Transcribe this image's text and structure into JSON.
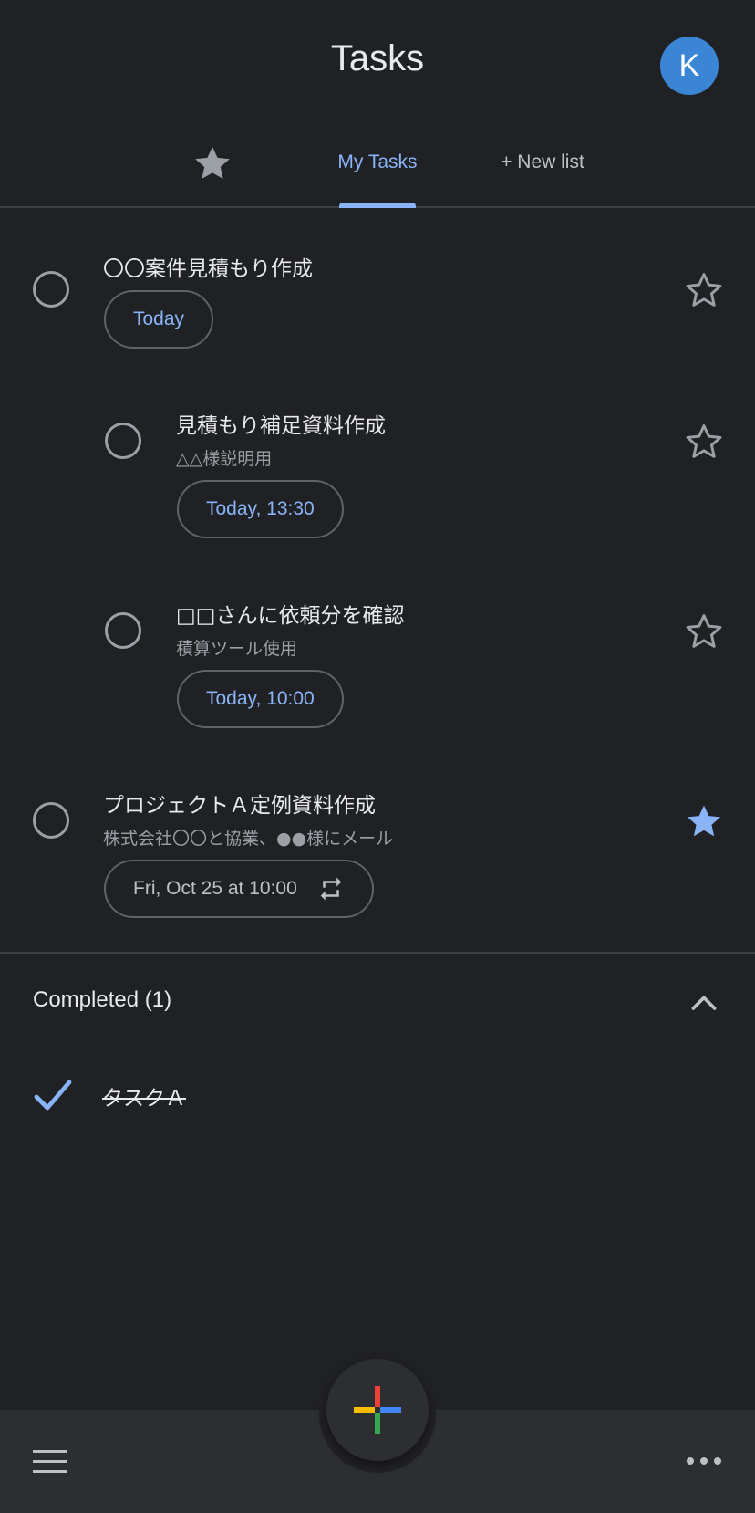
{
  "header": {
    "title": "Tasks",
    "avatar_initial": "K"
  },
  "tabs": {
    "starred_icon": "star-icon",
    "active": "My Tasks",
    "new_list": "+ New list"
  },
  "tasks": [
    {
      "title": "〇〇案件見積もり作成",
      "notes": "",
      "due": "Today",
      "starred": false,
      "indent": 0,
      "repeat": false
    },
    {
      "title": "見積もり補足資料作成",
      "notes": "△△様説明用",
      "due": "Today, 13:30",
      "starred": false,
      "indent": 1,
      "repeat": false
    },
    {
      "title": "□□さんに依頼分を確認",
      "notes": "積算ツール使用",
      "due": "Today, 10:00",
      "starred": false,
      "indent": 1,
      "repeat": false
    },
    {
      "title": "プロジェクトＡ定例資料作成",
      "notes": "株式会社〇〇と協業、●●様にメール",
      "due": "Fri, Oct 25 at 10:00",
      "starred": true,
      "indent": 0,
      "repeat": true
    }
  ],
  "completed": {
    "header": "Completed (1)",
    "items": [
      {
        "title": "タスクＡ"
      }
    ]
  },
  "bottom_bar": {
    "menu_icon": "menu-icon",
    "more_icon": "more-icon",
    "fab_icon": "add-icon"
  },
  "colors": {
    "background": "#202124",
    "accent": "#8ab4f8",
    "avatar": "#3b86d4",
    "bottom_bar": "#2d2e31"
  }
}
